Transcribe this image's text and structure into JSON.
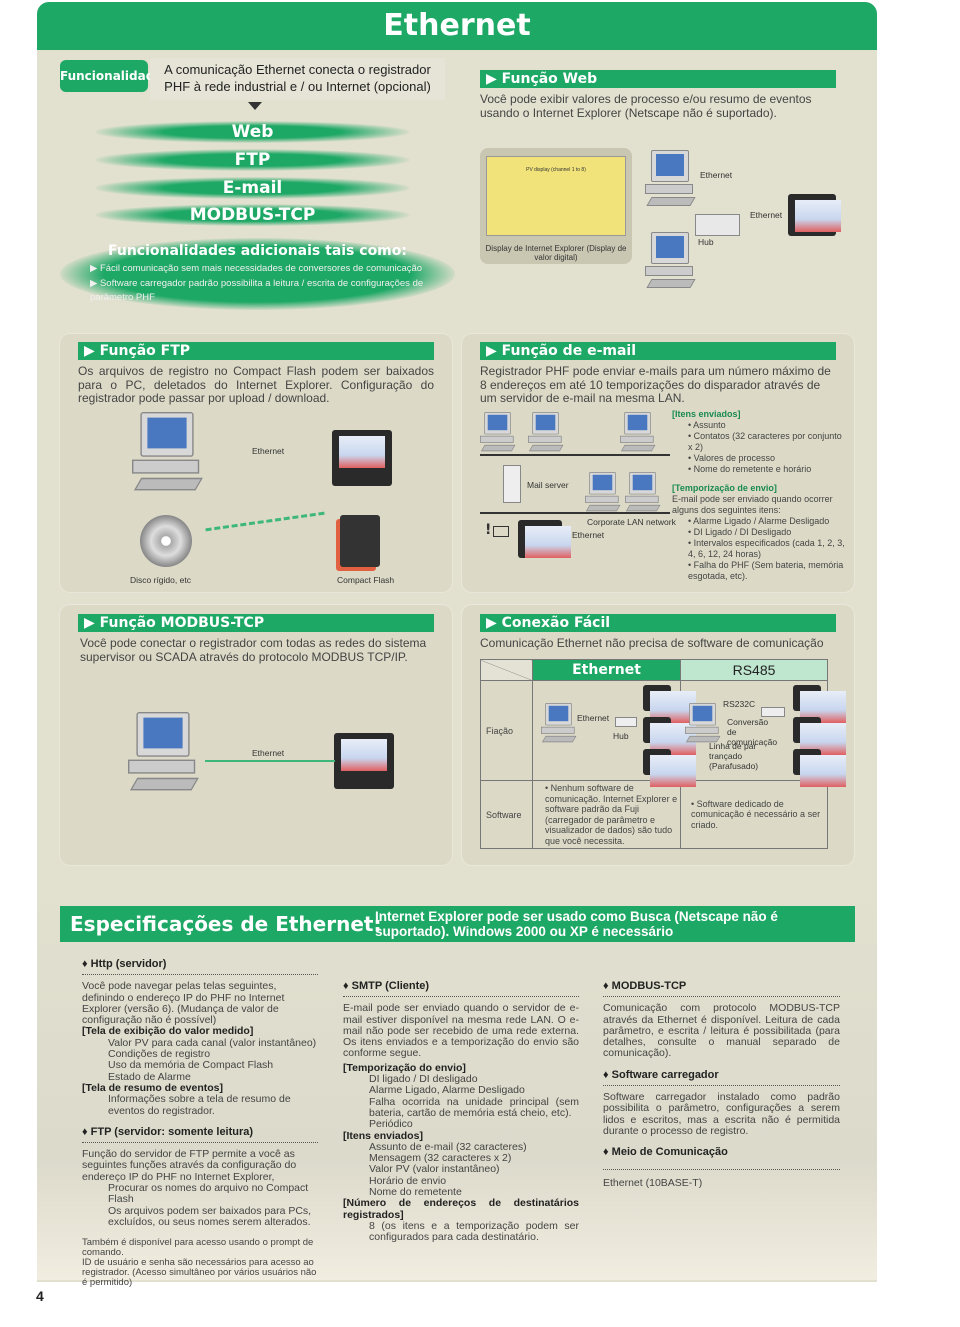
{
  "header": {
    "title": "Ethernet"
  },
  "intro": {
    "badge": "Funcionalidade",
    "text": "A comunicação Ethernet conecta o registrador PHF à rede industrial e / ou Internet (opcional)",
    "bands": [
      "Web",
      "FTP",
      "E-mail",
      "MODBUS-TCP"
    ],
    "extra_title": "Funcionalidades adicionais tais como:",
    "extra_items": [
      "Fácil comunicação sem mais necessidades de conversores de comunicação",
      "Software carregador padrão possibilita a leitura / escrita de configurações de parâmetro PHF"
    ]
  },
  "web": {
    "title": "Função Web",
    "text": "Você pode exibir valores de processo e/ou resumo de eventos usando o Internet Explorer (Netscape não é suportado).",
    "screen_title": "PV display (channel 1 to 8)",
    "caption": "Display de Internet Explorer (Display de valor digital)",
    "labels": {
      "ethernet1": "Ethernet",
      "ethernet2": "Ethernet",
      "hub": "Hub"
    }
  },
  "ftp": {
    "title": "Função FTP",
    "text": "Os arquivos de registro no Compact Flash podem ser baixados para o PC, deletados do Internet Explorer. Configuração do registrador pode passar por upload / download.",
    "labels": {
      "ethernet": "Ethernet",
      "disk": "Disco rígido, etc",
      "cf": "Compact Flash"
    }
  },
  "email": {
    "title": "Função de e-mail",
    "text": "Registrador PHF pode enviar e-mails para um número máximo de 8 endereços em até 10 temporizações do disparador através de um servidor de e-mail na mesma LAN.",
    "labels": {
      "mail_server": "Mail server",
      "lan": "Corporate LAN network",
      "ethernet": "Ethernet",
      "alert": "!"
    },
    "items_title": "[Itens enviados]",
    "items": [
      "Assunto",
      "Contatos (32 caracteres por conjunto x 2)",
      "Valores de processo",
      "Nome do remetente e horário"
    ],
    "timing_title": "[Temporização de envio]",
    "timing_text": "E-mail pode ser enviado quando ocorrer alguns dos seguintes itens:",
    "timing_items": [
      "Alarme Ligado / Alarme Desligado",
      "DI Ligado / DI Desligado",
      "Intervalos especificados (cada 1, 2, 3, 4, 6, 12, 24 horas)",
      "Falha do PHF (Sem bateria, memória esgotada, etc)."
    ]
  },
  "modbus": {
    "title": "Função MODBUS-TCP",
    "text": "Você pode conectar o registrador com todas as redes do sistema supervisor ou SCADA através do protocolo MODBUS TCP/IP.",
    "labels": {
      "ethernet": "Ethernet"
    }
  },
  "easy": {
    "title": "Conexão Fácil",
    "text": "Comunicação Ethernet não precisa de software de comunicação",
    "col_ethernet": "Ethernet",
    "col_rs485": "RS485",
    "row_wiring": "Fiação",
    "row_software": "Software",
    "eth_labels": {
      "ethernet": "Ethernet",
      "hub": "Hub"
    },
    "rs_labels": {
      "rs232c": "RS232C",
      "conv": "Conversão de comunicação",
      "line": "Linha de par trançado (Parafusado)"
    },
    "eth_software": "Nenhum software de comunicação. Internet Explorer e software padrão da Fuji (carregador de parâmetro e visualizador de dados) são tudo que você necessita.",
    "rs_software": "Software dedicado de comunicação é necessário a ser criado."
  },
  "specs": {
    "title": "Especificações de Ethernet:",
    "subtitle": "Internet Explorer pode ser usado como Busca (Netscape não é suportado). Windows 2000 ou XP é necessário",
    "http": {
      "title": "Http (servidor)",
      "text": "Você pode navegar pelas telas seguintes, definindo o endereço IP do PHF no Internet Explorer (versão 6). (Mudança de valor de configuração não é possível)",
      "s1": "[Tela de exibição do valor medido]",
      "s1_items": [
        "Valor  PV para cada canal (valor instantâneo)",
        "Condições de registro",
        "Uso da memória de Compact Flash",
        "Estado de Alarme"
      ],
      "s2": "[Tela de resumo de eventos]",
      "s2_items": [
        "Informações sobre a tela de resumo de eventos do registrador."
      ]
    },
    "ftp": {
      "title": "FTP (servidor: somente leitura)",
      "text": "Função do servidor de FTP permite a você as seguintes funções através da configuração do endereço IP do PHF no Internet Explorer,",
      "items": [
        "Procurar os nomes do arquivo no Compact Flash",
        "Os arquivos podem ser baixados para PCs, excluídos, ou seus nomes serem alterados."
      ],
      "note1": "Também é disponível para acesso usando o prompt de comando.",
      "note2": "ID de usuário e senha são necessários para acesso ao registrador. (Acesso simultâneo por vários usuários não é permitido)"
    },
    "smtp": {
      "title": "SMTP (Cliente)",
      "text": "E-mail pode ser enviado quando o servidor de e-mail estiver disponível na mesma rede LAN.  O e-mail não pode ser recebido de uma rede externa. Os itens enviados e a temporização do envio são conforme segue.",
      "s1": "[Temporização do envio]",
      "s1_items": [
        "DI ligado / DI desligado",
        "Alarme Ligado, Alarme Desligado",
        "Falha ocorrida na unidade principal (sem bateria, cartão de memória está cheio, etc).",
        "Periódico"
      ],
      "s2": "[Itens enviados]",
      "s2_items": [
        "Assunto de e-mail (32 caracteres)",
        "Mensagem (32 caracteres x 2)",
        "Valor PV (valor instantâneo)",
        "Horário de envio",
        "Nome do remetente"
      ],
      "s3": "[Número de endereços de destinatários registrados]",
      "s3_items": [
        "8 (os itens e a temporização podem ser configurados para cada destinatário."
      ]
    },
    "modbus": {
      "title": "MODBUS-TCP",
      "text": "Comunicação com protocolo MODBUS-TCP através da Ethernet é disponível. Leitura de cada parâmetro, e escrita / leitura é possibilitada (para detalhes, consulte o manual separado de comunicação)."
    },
    "loader": {
      "title": "Software carregador",
      "text": "Software carregador instalado como padrão possibilita o parâmetro, configurações a serem lidos e escritos, mas a escrita não é permitida durante o processo de registro."
    },
    "medium": {
      "title": "Meio de Comunicação",
      "text": "Ethernet (10BASE-T)"
    }
  },
  "page_number": "4",
  "colors": {
    "brand_green": "#1ea866",
    "background": "#e2e0cf"
  }
}
